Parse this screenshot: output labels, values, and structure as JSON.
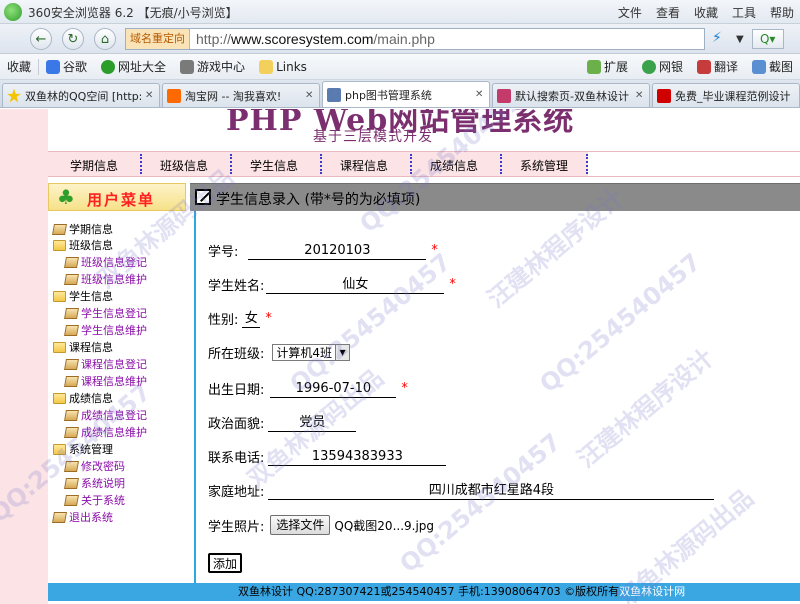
{
  "browser": {
    "title": "360安全浏览器 6.2 【无痕/小号浏览】",
    "menu": [
      "文件",
      "查看",
      "收藏",
      "工具",
      "帮助"
    ],
    "redirect_tag": "域名重定向",
    "url_prefix": "http://",
    "url_host": "www.scoresystem.com",
    "url_path": "/main.php",
    "bookmarks": [
      "收藏",
      "谷歌",
      "网址大全",
      "游戏中心",
      "Links",
      "扩展",
      "网银",
      "翻译",
      "截图"
    ],
    "tabs": [
      {
        "label": "双鱼林的QQ空间 [http:",
        "color": "#f5c400"
      },
      {
        "label": "淘宝网 -- 淘我喜欢!",
        "color": "#ff6a00"
      },
      {
        "label": "php图书管理系统",
        "color": "#5a7bb0"
      },
      {
        "label": "默认搜索页-双鱼林设计",
        "color": "#c23b6b"
      },
      {
        "label": "免费_毕业课程范例设计",
        "color": "#d00000"
      }
    ]
  },
  "site": {
    "title": "PHP Web网站管理系统",
    "subtitle": "基于三层模式开发",
    "nav": [
      "学期信息",
      "班级信息",
      "学生信息",
      "课程信息",
      "成绩信息",
      "系统管理"
    ]
  },
  "sidebar": {
    "heading": "用户菜单",
    "items": [
      {
        "label": "学期信息",
        "type": "root"
      },
      {
        "label": "班级信息",
        "type": "folder"
      },
      {
        "label": "班级信息登记",
        "type": "leaf"
      },
      {
        "label": "班级信息维护",
        "type": "leaf"
      },
      {
        "label": "学生信息",
        "type": "folder"
      },
      {
        "label": "学生信息登记",
        "type": "leaf"
      },
      {
        "label": "学生信息维护",
        "type": "leaf"
      },
      {
        "label": "课程信息",
        "type": "folder"
      },
      {
        "label": "课程信息登记",
        "type": "leaf"
      },
      {
        "label": "课程信息维护",
        "type": "leaf"
      },
      {
        "label": "成绩信息",
        "type": "folder"
      },
      {
        "label": "成绩信息登记",
        "type": "leaf"
      },
      {
        "label": "成绩信息维护",
        "type": "leaf"
      },
      {
        "label": "系统管理",
        "type": "folder"
      },
      {
        "label": "修改密码",
        "type": "leaf"
      },
      {
        "label": "系统说明",
        "type": "leaf"
      },
      {
        "label": "关于系统",
        "type": "leaf"
      },
      {
        "label": "退出系统",
        "type": "root-leaf"
      }
    ]
  },
  "form": {
    "header": "学生信息录入 (带*号的为必填项)",
    "student_no_label": "学号:",
    "student_no_value": "20120103",
    "name_label": "学生姓名:",
    "name_value": "仙女",
    "gender_label": "性别:",
    "gender_value": "女",
    "class_label": "所在班级:",
    "class_value": "计算机4班",
    "birth_label": "出生日期:",
    "birth_value": "1996-07-10",
    "politics_label": "政治面貌:",
    "politics_value": "党员",
    "phone_label": "联系电话:",
    "phone_value": "13594383933",
    "address_label": "家庭地址:",
    "address_value": "四川成都市红星路4段",
    "photo_label": "学生照片:",
    "choose_file_label": "选择文件",
    "file_name": "QQ截图20...9.jpg",
    "submit_label": "添加",
    "required_mark": "*"
  },
  "footer": {
    "text": "双鱼林设计 QQ:287307421或254540457 手机:13908064703 ©版权所有",
    "link": "双鱼林设计网"
  },
  "watermarks": [
    "汪建林程序设计",
    "双鱼林源码出品",
    "QQ:254540457"
  ]
}
